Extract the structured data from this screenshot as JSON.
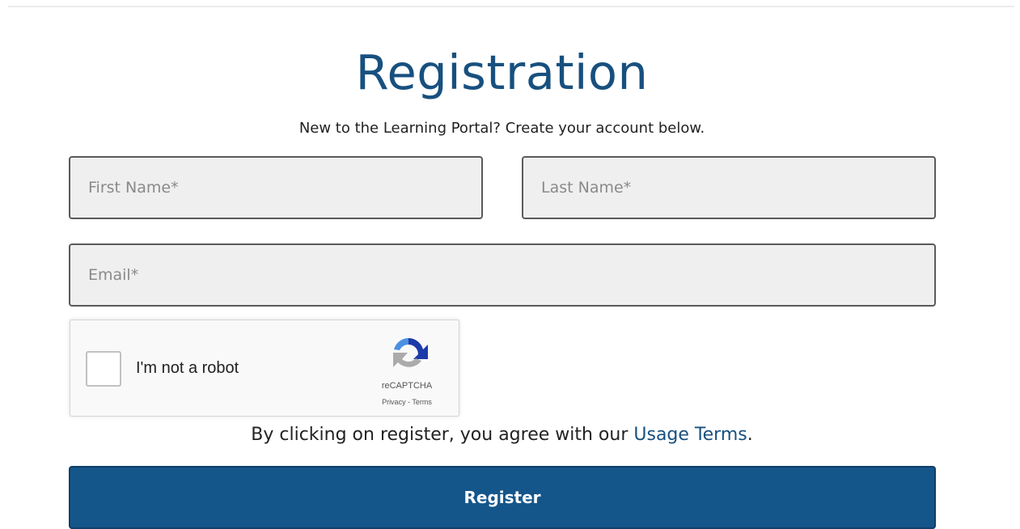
{
  "page": {
    "title": "Registration",
    "subtitle": "New to the Learning Portal? Create your account below."
  },
  "form": {
    "first_name": {
      "placeholder": "First Name*",
      "value": ""
    },
    "last_name": {
      "placeholder": "Last Name*",
      "value": ""
    },
    "email": {
      "placeholder": "Email*",
      "value": ""
    }
  },
  "captcha": {
    "label": "I'm not a robot",
    "brand": "reCAPTCHA",
    "privacy_link": "Privacy",
    "separator": " - ",
    "terms_link": "Terms",
    "checked": false,
    "icon": "recaptcha-icon"
  },
  "agreement": {
    "prefix": "By clicking on register, you agree with our ",
    "link_text": "Usage Terms",
    "suffix": "."
  },
  "actions": {
    "register_label": "Register"
  },
  "colors": {
    "title": "#17507f",
    "link": "#17507f",
    "button_bg": "#15568a",
    "field_bg": "#efefef",
    "field_border": "#5a5a5a"
  }
}
